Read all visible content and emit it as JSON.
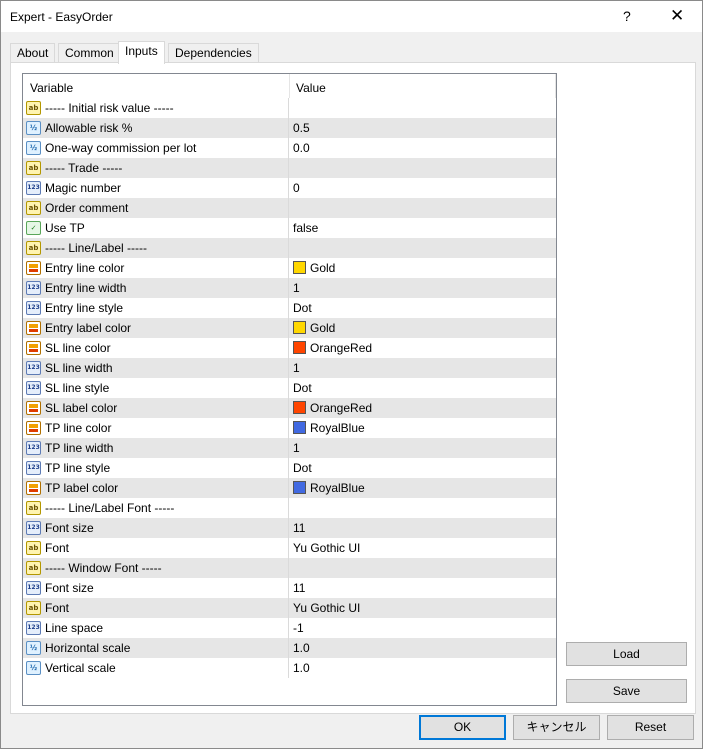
{
  "window": {
    "title": "Expert - EasyOrder",
    "help_glyph": "?",
    "close_glyph": "✕"
  },
  "tabs": [
    "About",
    "Common",
    "Inputs",
    "Dependencies"
  ],
  "active_tab": "Inputs",
  "grid": {
    "headers": {
      "variable": "Variable",
      "value": "Value"
    },
    "rows": [
      {
        "type": "ab",
        "variable": "----- Initial risk value -----",
        "value": ""
      },
      {
        "type": "half",
        "variable": "Allowable risk %",
        "value": "0.5"
      },
      {
        "type": "half",
        "variable": "One-way commission per lot",
        "value": "0.0"
      },
      {
        "type": "ab",
        "variable": "----- Trade -----",
        "value": ""
      },
      {
        "type": "123",
        "variable": "Magic number",
        "value": "0"
      },
      {
        "type": "ab",
        "variable": "Order comment",
        "value": ""
      },
      {
        "type": "bool",
        "variable": "Use TP",
        "value": "false"
      },
      {
        "type": "ab",
        "variable": "----- Line/Label -----",
        "value": ""
      },
      {
        "type": "color",
        "variable": "Entry line color",
        "value": "Gold",
        "swatch": "#ffd700"
      },
      {
        "type": "123",
        "variable": "Entry line width",
        "value": "1"
      },
      {
        "type": "123",
        "variable": "Entry line style",
        "value": "Dot"
      },
      {
        "type": "color",
        "variable": "Entry label color",
        "value": "Gold",
        "swatch": "#ffd700"
      },
      {
        "type": "color",
        "variable": "SL line color",
        "value": "OrangeRed",
        "swatch": "#ff4500"
      },
      {
        "type": "123",
        "variable": "SL line width",
        "value": "1"
      },
      {
        "type": "123",
        "variable": "SL line style",
        "value": "Dot"
      },
      {
        "type": "color",
        "variable": "SL label color",
        "value": "OrangeRed",
        "swatch": "#ff4500"
      },
      {
        "type": "color",
        "variable": "TP line color",
        "value": "RoyalBlue",
        "swatch": "#4169e1"
      },
      {
        "type": "123",
        "variable": "TP line width",
        "value": "1"
      },
      {
        "type": "123",
        "variable": "TP line style",
        "value": "Dot"
      },
      {
        "type": "color",
        "variable": "TP label color",
        "value": "RoyalBlue",
        "swatch": "#4169e1"
      },
      {
        "type": "ab",
        "variable": "----- Line/Label Font -----",
        "value": ""
      },
      {
        "type": "123",
        "variable": "Font size",
        "value": "11"
      },
      {
        "type": "ab",
        "variable": "Font",
        "value": "Yu Gothic UI"
      },
      {
        "type": "ab",
        "variable": "----- Window Font -----",
        "value": ""
      },
      {
        "type": "123",
        "variable": "Font size",
        "value": "11"
      },
      {
        "type": "ab",
        "variable": "Font",
        "value": "Yu Gothic UI"
      },
      {
        "type": "123",
        "variable": "Line space",
        "value": "-1"
      },
      {
        "type": "half",
        "variable": "Horizontal scale",
        "value": "1.0"
      },
      {
        "type": "half",
        "variable": "Vertical scale",
        "value": "1.0"
      }
    ]
  },
  "icon_labels": {
    "ab": "ab",
    "half": "½",
    "123": "123",
    "bool": "✓",
    "color": ""
  },
  "side_buttons": {
    "load": "Load",
    "save": "Save"
  },
  "footer_buttons": {
    "ok": "OK",
    "cancel": "キャンセル",
    "reset": "Reset"
  },
  "colors": {
    "accent": "#0078d7",
    "row_alt": "#e6e6e6"
  }
}
